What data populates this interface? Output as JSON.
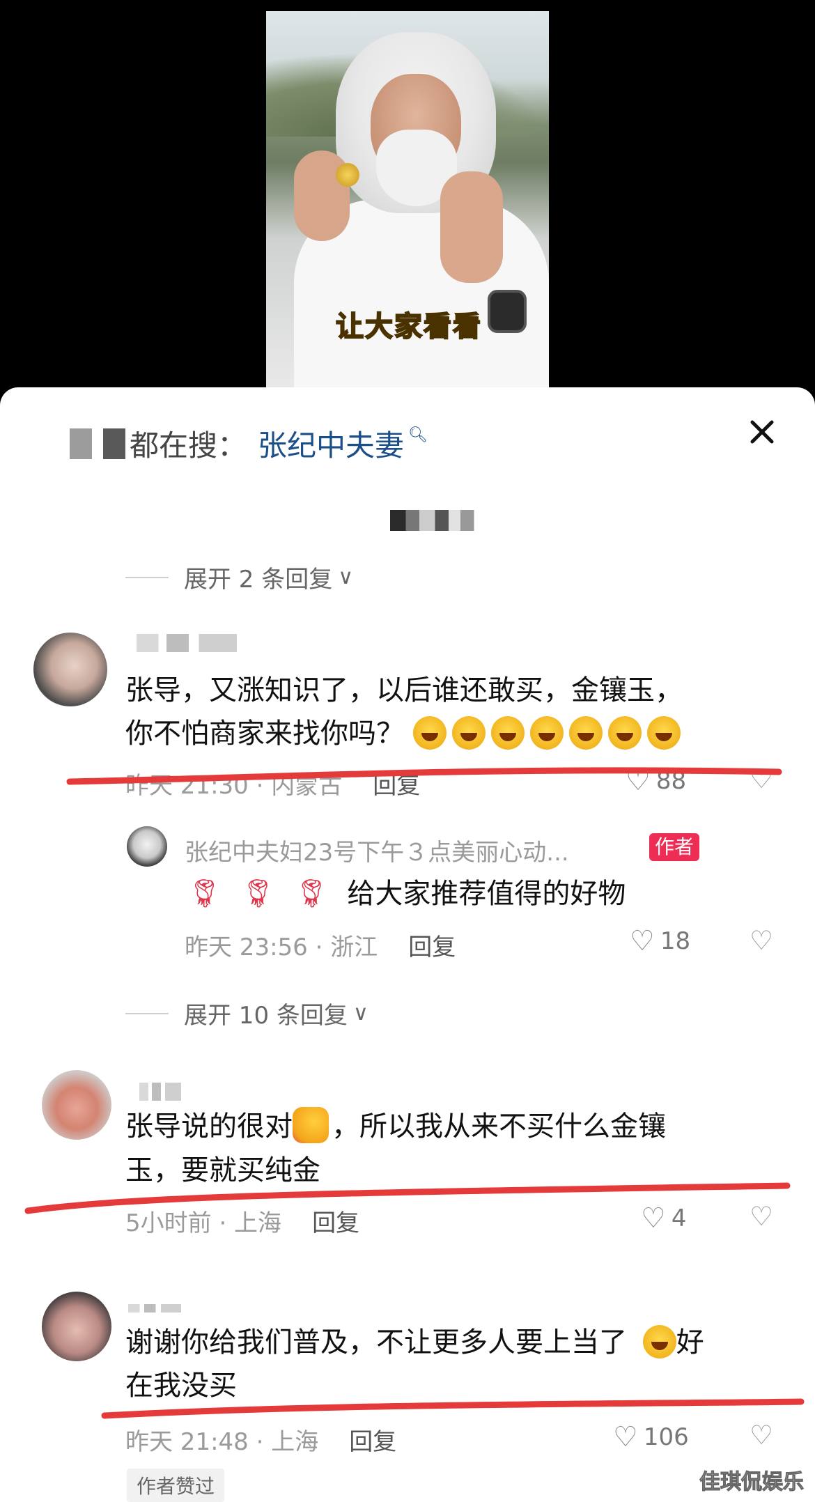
{
  "video": {
    "caption": "让大家看看"
  },
  "search_hint": {
    "prefix": "都在搜：",
    "term": "张纪中夫妻"
  },
  "expand_1": {
    "label": "展开 2 条回复"
  },
  "comment_1": {
    "text_line1": "张导，又涨知识了，以后谁还敢买，金镶玉，",
    "text_line2": "你不怕商家来找你吗？",
    "emoji_count": 7,
    "time": "昨天 21:30 · 内蒙古",
    "reply_label": "回复",
    "likes": "88"
  },
  "author_reply": {
    "name": "张纪中夫妇23号下午３点美丽心动...",
    "badge": "作者",
    "text": "给大家推荐值得的好物",
    "time": "昨天 23:56 · 浙江",
    "reply_label": "回复",
    "likes": "18"
  },
  "expand_2": {
    "label": "展开 10 条回复"
  },
  "comment_2": {
    "text_part1": "张导说的很对",
    "text_part2": "，所以我从来不买什么金镶",
    "text_line2": "玉，要就买纯金",
    "time": "5小时前 · 上海",
    "reply_label": "回复",
    "likes": "4"
  },
  "comment_3": {
    "text_part1": "谢谢你给我们普及，不让更多人要上当了",
    "text_part2": "好",
    "text_line2": "在我没买",
    "time": "昨天 21:48 · 上海",
    "reply_label": "回复",
    "likes": "106",
    "author_liked": "作者赞过"
  },
  "watermark": "佳琪侃娱乐",
  "colors": {
    "search_term": "#1a4f8a",
    "author_badge": "#ee2d55",
    "annotation_stroke": "#e53a3a"
  }
}
